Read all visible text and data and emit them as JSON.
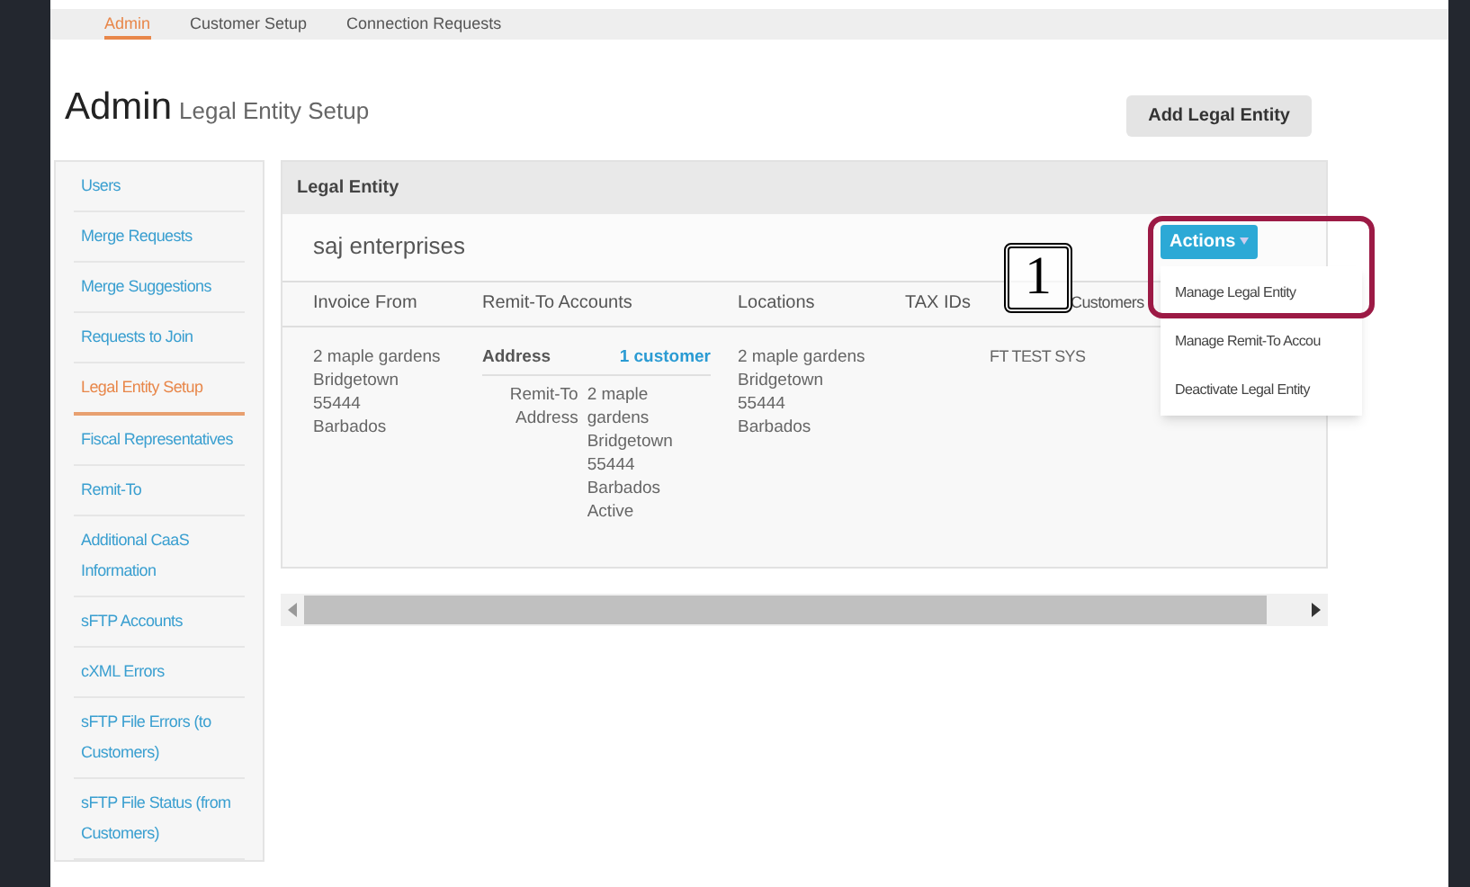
{
  "top_nav": [
    {
      "label": "Admin",
      "selected": true
    },
    {
      "label": "Customer Setup",
      "selected": false
    },
    {
      "label": "Connection Requests",
      "selected": false
    }
  ],
  "page_title": {
    "title": "Admin",
    "subtitle": "Legal Entity Setup"
  },
  "add_button": "Add Legal Entity",
  "sidebar": {
    "items": [
      {
        "label": "Users",
        "selected": false
      },
      {
        "label": "Merge Requests",
        "selected": false
      },
      {
        "label": "Merge Suggestions",
        "selected": false
      },
      {
        "label": "Requests to Join",
        "selected": false
      },
      {
        "label": "Legal Entity Setup",
        "selected": true
      },
      {
        "label": "Fiscal Representatives",
        "selected": false
      },
      {
        "label": "Remit-To",
        "selected": false
      },
      {
        "label": "Additional CaaS Information",
        "selected": false
      },
      {
        "label": "sFTP Accounts",
        "selected": false
      },
      {
        "label": "cXML Errors",
        "selected": false
      },
      {
        "label": "sFTP File Errors (to Customers)",
        "selected": false
      },
      {
        "label": "sFTP File Status (from Customers)",
        "selected": false
      }
    ]
  },
  "panel": {
    "header": "Legal Entity",
    "entity_name": "saj enterprises",
    "columns": [
      "Invoice From",
      "Remit-To Accounts",
      "Locations",
      "TAX IDs",
      "Customers"
    ],
    "invoice_from": [
      "2 maple gardens",
      "Bridgetown",
      "55444",
      "Barbados"
    ],
    "remit_to": {
      "heading": "Address",
      "link": "1 customer",
      "label": "Remit-To Address",
      "lines": [
        "2 maple gardens",
        "Bridgetown",
        "55444",
        "Barbados",
        "Active"
      ]
    },
    "locations": [
      "2 maple gardens",
      "Bridgetown",
      "55444",
      "Barbados"
    ],
    "customer": "FT TEST SYS"
  },
  "actions": {
    "button": "Actions",
    "items": [
      "Manage Legal Entity",
      "Manage Remit-To Accou",
      "Deactivate Legal Entity"
    ]
  },
  "callout": "1"
}
